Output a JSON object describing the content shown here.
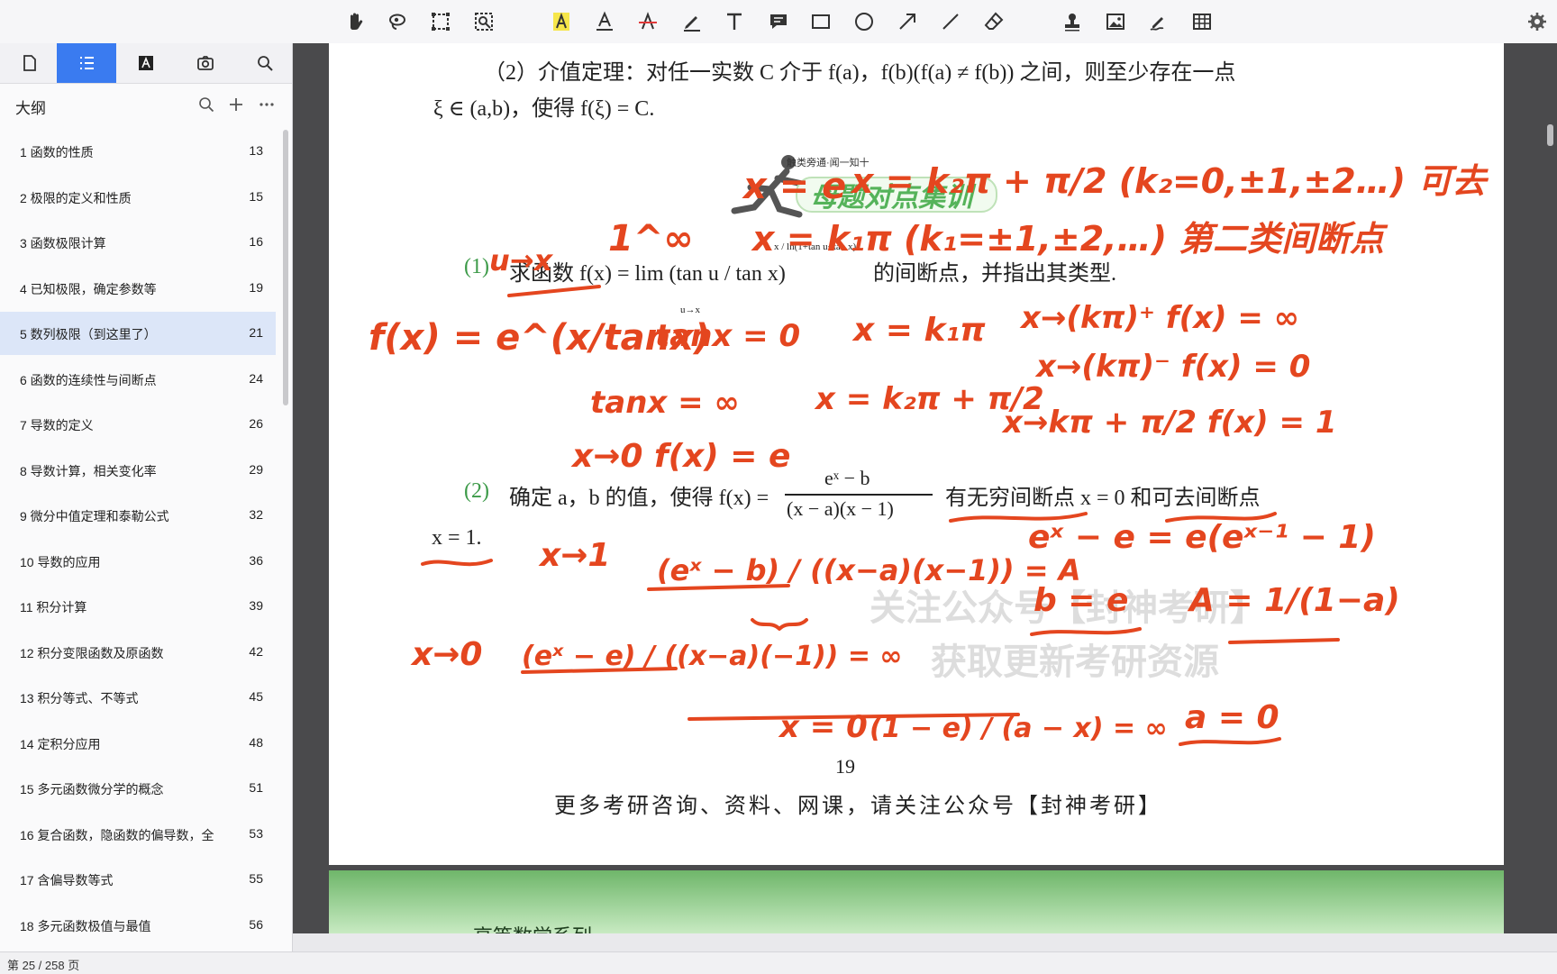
{
  "toolbar": {
    "tools": [
      "hand-icon",
      "lasso-select-icon",
      "rect-select-icon",
      "zoom-select-icon",
      "highlight-text-icon",
      "underline-text-icon",
      "strikethrough-text-icon",
      "pencil-icon",
      "text-icon",
      "comment-icon",
      "rectangle-icon",
      "circle-icon",
      "arrow-icon",
      "line-icon",
      "eraser-icon",
      "stamp-icon",
      "image-icon",
      "signature-icon",
      "table-icon"
    ],
    "settings": "gear-icon"
  },
  "sidebar": {
    "tabs": [
      "page-thumbnails-icon",
      "outline-icon",
      "annotation-icon",
      "snapshot-icon",
      "search-icon"
    ],
    "outline_title": "大纲",
    "items": [
      {
        "label": "1 函数的性质",
        "page": "13"
      },
      {
        "label": "2 极限的定义和性质",
        "page": "15"
      },
      {
        "label": "3 函数极限计算",
        "page": "16"
      },
      {
        "label": "4 已知极限，确定参数等",
        "page": "19"
      },
      {
        "label": "5 数列极限（到这里了）",
        "page": "21"
      },
      {
        "label": "6 函数的连续性与间断点",
        "page": "24"
      },
      {
        "label": "7 导数的定义",
        "page": "26"
      },
      {
        "label": "8 导数计算，相关变化率",
        "page": "29"
      },
      {
        "label": "9 微分中值定理和泰勒公式",
        "page": "32"
      },
      {
        "label": "10 导数的应用",
        "page": "36"
      },
      {
        "label": "11 积分计算",
        "page": "39"
      },
      {
        "label": "12 积分变限函数及原函数",
        "page": "42"
      },
      {
        "label": "13 积分等式、不等式",
        "page": "45"
      },
      {
        "label": "14 定积分应用",
        "page": "48"
      },
      {
        "label": "15 多元函数微分学的概念",
        "page": "51"
      },
      {
        "label": "16 复合函数，隐函数的偏导数，全",
        "page": "53"
      },
      {
        "label": "17 含偏导数等式",
        "page": "55"
      },
      {
        "label": "18 多元函数极值与最值",
        "page": "56"
      }
    ]
  },
  "document": {
    "line1": "（2）介值定理：对任一实数 C 介于 f(a)，f(b)(f(a) ≠ f(b)) 之间，则至少存在一点",
    "line2": "ξ ∈ (a,b)，使得 f(ξ) = C.",
    "banner_small": "触类旁通·闻一知十",
    "banner_big": "母题对点集训",
    "q1_num": "(1)",
    "q1_text": "求函数 f(x) = lim (tan u / tan x)",
    "q1_suffix": "的间断点，并指出其类型.",
    "q1_limit_sub": "u→x",
    "q1_exponent": "x / ln(1+tan u−tan x)",
    "q2_num": "(2)",
    "q2_text": "确定 a，b 的值，使得 f(x) =",
    "q2_numerator": "eˣ − b",
    "q2_denominator": "(x − a)(x − 1)",
    "q2_suffix": "有无穷间断点 x = 0 和可去间断点",
    "q2_line2": "x = 1.",
    "watermark1": "关注公众号【封神考研】",
    "watermark2": "获取更新考研资源",
    "page_number": "19",
    "footer": "更多考研咨询、资料、网课，请关注公众号【封神考研】",
    "next_page_title": "高等数学系列"
  },
  "handwriting": {
    "h1": "x = e",
    "h2": "x = k₂π + π/2 (k₂=0,±1,±2…) 可去",
    "h3": "x = k₁π (k₁=±1,±2,…) 第二类间断点",
    "h4": "1^∞",
    "h5": "u→x",
    "h6": "f(x) = e^(x/tanx)",
    "h7": "tanx = 0",
    "h8": "x = k₁π",
    "h9": "x→(kπ)⁺ f(x) = ∞",
    "h10": "x→(kπ)⁻ f(x) = 0",
    "h11": "tanx = ∞",
    "h12": "x = k₂π + π/2",
    "h13": "x→kπ + π/2 f(x) = 1",
    "h14": "x→0 f(x) = e",
    "h15": "x→1",
    "h16": "(eˣ − b) / ((x−a)(x−1)) = A",
    "h17": "eˣ − e = e(eˣ⁻¹ − 1)",
    "h18": "b = e",
    "h19": "A = 1/(1−a)",
    "h20": "x→0",
    "h21": "(eˣ − e) / ((x−a)(−1)) = ∞",
    "h22": "x = 0",
    "h23": "(1 − e) / (a − x) = ∞",
    "h24": "a = 0"
  },
  "status": {
    "page_indicator": "第 25 / 258 页"
  },
  "colors": {
    "accent": "#3a7bf0",
    "ink": "#e4461f",
    "question_green": "#3c9a48",
    "selected_row": "#dce6f8"
  }
}
